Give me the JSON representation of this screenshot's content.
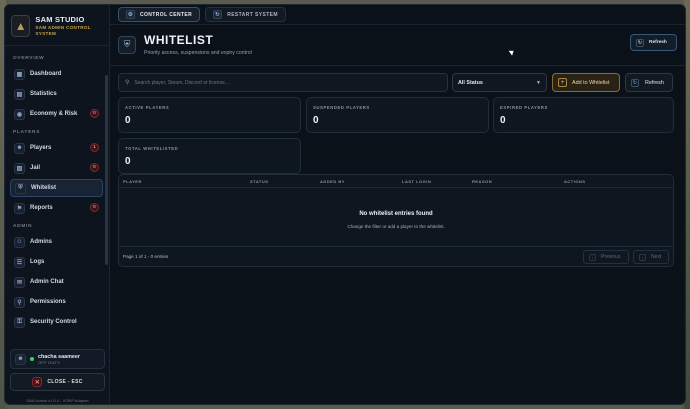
{
  "brand": {
    "title": "SAM STUDIO",
    "subtitle": "SAM ADMIN CONTROL SYSTEM",
    "logo_icon": "wolf-logo-icon"
  },
  "sidebar": {
    "sections": [
      {
        "label": "OVERVIEW",
        "items": [
          {
            "label": "Dashboard",
            "icon": "grid-icon"
          },
          {
            "label": "Statistics",
            "icon": "chart-icon"
          },
          {
            "label": "Economy & Risk",
            "icon": "coin-icon",
            "badge": "0"
          }
        ]
      },
      {
        "label": "PLAYERS",
        "items": [
          {
            "label": "Players",
            "icon": "users-icon",
            "badge": "1"
          },
          {
            "label": "Jail",
            "icon": "jail-icon",
            "badge": "0"
          },
          {
            "label": "Whitelist",
            "icon": "shield-icon",
            "active": true
          },
          {
            "label": "Reports",
            "icon": "flag-icon",
            "badge": "0"
          }
        ]
      },
      {
        "label": "ADMIN",
        "items": [
          {
            "label": "Admins",
            "icon": "admin-icon"
          },
          {
            "label": "Logs",
            "icon": "logs-icon"
          },
          {
            "label": "Admin Chat",
            "icon": "chat-icon"
          },
          {
            "label": "Permissions",
            "icon": "key-icon"
          },
          {
            "label": "Security Control",
            "icon": "lock-icon"
          }
        ]
      }
    ]
  },
  "user": {
    "name": "chacha saameer",
    "status": "OFF DUTY"
  },
  "close_label": "CLOSE - ESC",
  "version": "SAM Admin v1.0.0 - VORP Adapter",
  "topbar": {
    "tabs": [
      {
        "label": "CONTROL CENTER",
        "active": true
      },
      {
        "label": "RESTART SYSTEM",
        "active": false
      }
    ]
  },
  "header": {
    "title": "WHITELIST",
    "subtitle": "Priority access, suspensions and expiry control",
    "refresh_label": "Refresh"
  },
  "filters": {
    "search_placeholder": "Search player, Steam, Discord or license...",
    "status_selected": "All Status",
    "add_label": "Add to Whitelist",
    "refresh_label": "Refresh"
  },
  "stats": [
    {
      "label": "ACTIVE PLAYERS",
      "value": "0"
    },
    {
      "label": "SUSPENDED PLAYERS",
      "value": "0"
    },
    {
      "label": "EXPIRED PLAYERS",
      "value": "0"
    },
    {
      "label": "TOTAL WHITELISTED",
      "value": "0"
    }
  ],
  "table": {
    "columns": [
      "PLAYER",
      "STATUS",
      "ADDED BY",
      "LAST LOGIN",
      "REASON",
      "ACTIONS"
    ],
    "empty_title": "No whitelist entries found",
    "empty_subtitle": "Change the filter or add a player to the whitelist.",
    "page_info": "Page 1 of 1 - 0 entries",
    "prev_label": "Previous",
    "next_label": "Next"
  }
}
